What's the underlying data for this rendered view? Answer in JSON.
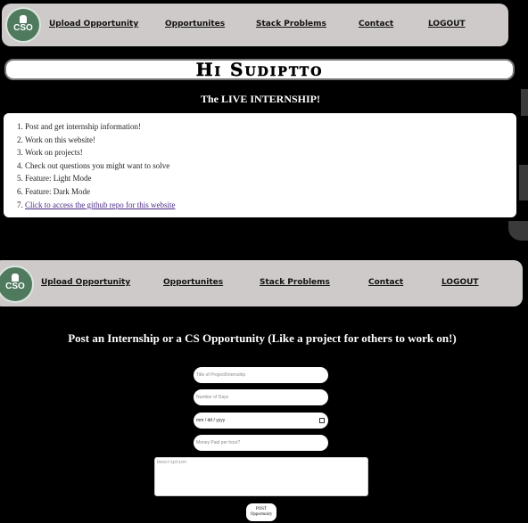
{
  "logo_text": "CSO",
  "nav": {
    "upload": "Upload Opportunity",
    "opportunities": "Opportunites",
    "stack": "Stack Problems",
    "contact": "Contact",
    "logout": "LOGOUT"
  },
  "greeting": "Hi Sudiptto",
  "subtitle": "The LIVE INTERNSHIP!",
  "features": [
    "Post and get internship information!",
    "Work on this website!",
    "Work on projects!",
    "Check out questions you might want to solve",
    "Feature: Light Mode",
    "Feature: Dark Mode",
    "Click to access the github repo for this website"
  ],
  "form": {
    "heading": "Post an Internship or a CS Opportunity (Like a project for others to work on!)",
    "title_placeholder": "Title of Project/Internship",
    "days_placeholder": "Number of Days",
    "date_value": "mm / dd / yyyy",
    "money_placeholder": "Money Paid per hour?",
    "description_placeholder": "Description",
    "post_label": "POST Opportunity"
  }
}
